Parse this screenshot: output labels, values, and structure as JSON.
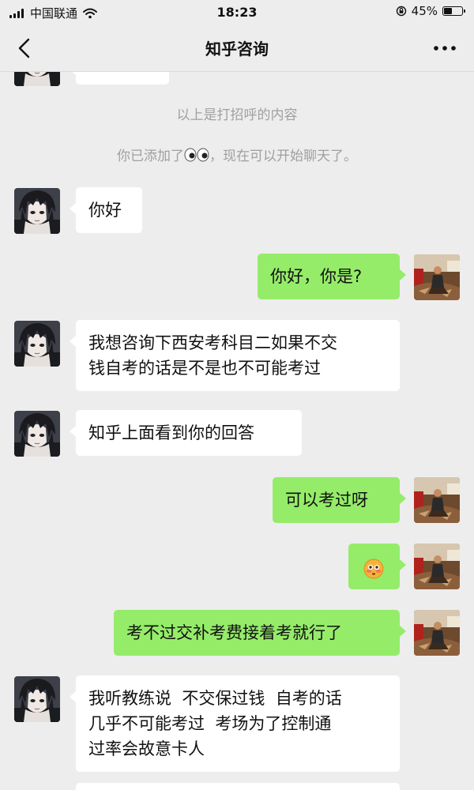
{
  "status_bar": {
    "carrier": "中国联通",
    "time": "18:23",
    "battery": "45%",
    "battery_level": 0.45
  },
  "nav": {
    "title": "知乎咨询",
    "back_icon": "chevron-left-icon",
    "more_icon": "more-dots-icon"
  },
  "system": {
    "greeting_note": "以上是打招呼的内容",
    "added_prefix": "你已添加了",
    "added_emoji": "eyes-emoji",
    "added_suffix": "，现在可以开始聊天了。"
  },
  "messages": [
    {
      "side": "in",
      "lines": [
        "你好"
      ]
    },
    {
      "side": "out",
      "lines": [
        "你好，你是?"
      ]
    },
    {
      "side": "in",
      "lines": [
        "我想咨询下西安考科目二如果不交",
        "钱自考的话是不是也不可能考过"
      ]
    },
    {
      "side": "in",
      "lines": [
        "知乎上面看到你的回答"
      ]
    },
    {
      "side": "out",
      "lines": [
        "可以考过呀"
      ]
    },
    {
      "side": "out",
      "emoji": "flushed-face-emoji"
    },
    {
      "side": "out",
      "lines": [
        "考不过交补考费接着考就行了"
      ]
    },
    {
      "side": "in",
      "lines": [
        "我听教练说  不交保过钱  自考的话",
        "几乎不可能考过  考场为了控制通",
        "过率会故意卡人"
      ]
    }
  ],
  "colors": {
    "background": "#ededed",
    "bubble_in": "#ffffff",
    "bubble_out": "#95ec69",
    "system_text": "#a0a0a0"
  }
}
